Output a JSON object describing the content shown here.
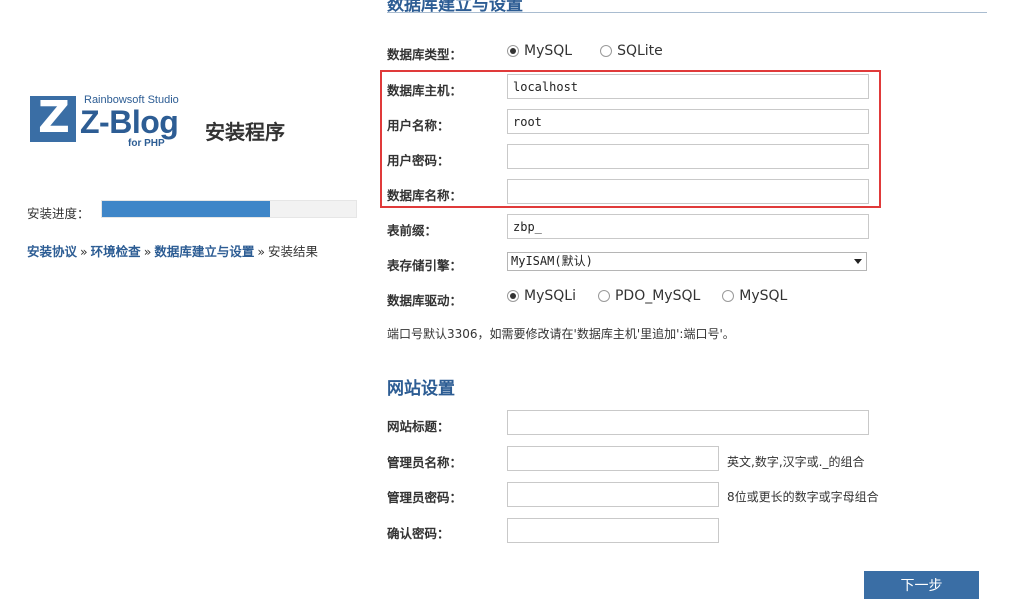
{
  "logo": {
    "studio": "Rainbowsoft Studio",
    "letter": "Z",
    "name": "Z-Blog",
    "sub": "for PHP",
    "install": "安装程序"
  },
  "progress": {
    "label": "安装进度：",
    "percent": 66
  },
  "steps": [
    {
      "label": "安装协议",
      "state": "done"
    },
    {
      "label": "环境检查",
      "state": "done"
    },
    {
      "label": "数据库建立与设置",
      "state": "done"
    },
    {
      "label": "安装结果",
      "state": "current"
    }
  ],
  "step_separator": "»",
  "db": {
    "title": "数据库建立与设置",
    "type_label": "数据库类型：",
    "type_options": [
      "MySQL",
      "SQLite"
    ],
    "type_selected": "MySQL",
    "host_label": "数据库主机：",
    "host_value": "localhost",
    "user_label": "用户名称：",
    "user_value": "root",
    "pass_label": "用户密码：",
    "pass_value": "",
    "name_label": "数据库名称：",
    "name_value": "",
    "prefix_label": "表前缀：",
    "prefix_value": "zbp_",
    "engine_label": "表存储引擎：",
    "engine_value": "MyISAM(默认)",
    "driver_label": "数据库驱动：",
    "driver_options": [
      "MySQLi",
      "PDO_MySQL",
      "MySQL"
    ],
    "driver_selected": "MySQLi",
    "note": "端口号默认3306，如需要修改请在'数据库主机'里追加':端口号'。"
  },
  "site": {
    "title": "网站设置",
    "site_title_label": "网站标题：",
    "site_title_value": "",
    "admin_name_label": "管理员名称：",
    "admin_name_value": "",
    "admin_name_hint": "英文,数字,汉字或._的组合",
    "admin_pass_label": "管理员密码：",
    "admin_pass_value": "",
    "admin_pass_hint": "8位或更长的数字或字母组合",
    "confirm_label": "确认密码：",
    "confirm_value": ""
  },
  "next_button": "下一步",
  "colors": {
    "brand": "#3a6ea5",
    "progress": "#3f86c8",
    "highlight": "#e03a3a"
  }
}
